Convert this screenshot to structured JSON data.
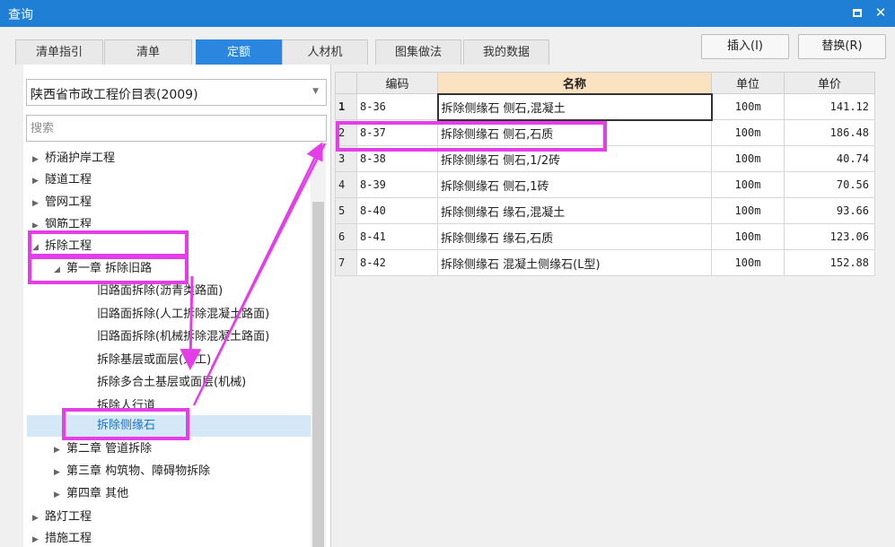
{
  "window": {
    "title": "查询",
    "buttons": {
      "maximize": "",
      "close": "✕"
    }
  },
  "tabs": [
    {
      "label": "清单指引",
      "active": false
    },
    {
      "label": "清单",
      "active": false
    },
    {
      "label": "定额",
      "active": true
    },
    {
      "label": "人材机",
      "active": false
    },
    {
      "label": "图集做法",
      "active": false
    },
    {
      "label": "我的数据",
      "active": false
    }
  ],
  "actions": {
    "insert": "插入(I)",
    "replace": "替换(R)"
  },
  "library": {
    "selected": "陕西省市政工程价目表(2009)"
  },
  "search": {
    "placeholder": "搜索",
    "value": ""
  },
  "tree": [
    {
      "label": "桥涵护岸工程",
      "arrow": "▶"
    },
    {
      "label": "隧道工程",
      "arrow": "▶"
    },
    {
      "label": "管网工程",
      "arrow": "▶"
    },
    {
      "label": "钢筋工程",
      "arrow": "▶"
    },
    {
      "label": "拆除工程",
      "arrow": "◢"
    },
    {
      "label": "第一章 拆除旧路",
      "arrow": "◢"
    },
    {
      "label": "旧路面拆除(沥青类路面)"
    },
    {
      "label": "旧路面拆除(人工拆除混凝土路面)"
    },
    {
      "label": "旧路面拆除(机械拆除混凝土路面)"
    },
    {
      "label": "拆除基层或面层(人工)"
    },
    {
      "label": "拆除多合土基层或面层(机械)"
    },
    {
      "label": "拆除人行道"
    },
    {
      "label": "拆除侧缘石",
      "selected": true
    },
    {
      "label": "第二章 管道拆除",
      "arrow": "▶"
    },
    {
      "label": "第三章 构筑物、障碍物拆除",
      "arrow": "▶"
    },
    {
      "label": "第四章 其他",
      "arrow": "▶"
    },
    {
      "label": "路灯工程",
      "arrow": "▶"
    },
    {
      "label": "措施工程",
      "arrow": "▶"
    }
  ],
  "grid": {
    "headers": {
      "code": "编码",
      "name": "名称",
      "unit": "单位",
      "price": "单价"
    },
    "rows": [
      {
        "no": "1",
        "code": "8-36",
        "name": "拆除侧缘石 侧石,混凝土",
        "unit": "100m",
        "price": "141.12"
      },
      {
        "no": "2",
        "code": "8-37",
        "name": "拆除侧缘石 侧石,石质",
        "unit": "100m",
        "price": "186.48"
      },
      {
        "no": "3",
        "code": "8-38",
        "name": "拆除侧缘石 侧石,1/2砖",
        "unit": "100m",
        "price": "40.74"
      },
      {
        "no": "4",
        "code": "8-39",
        "name": "拆除侧缘石 侧石,1砖",
        "unit": "100m",
        "price": "70.56"
      },
      {
        "no": "5",
        "code": "8-40",
        "name": "拆除侧缘石 缘石,混凝土",
        "unit": "100m",
        "price": "93.66"
      },
      {
        "no": "6",
        "code": "8-41",
        "name": "拆除侧缘石 缘石,石质",
        "unit": "100m",
        "price": "123.06"
      },
      {
        "no": "7",
        "code": "8-42",
        "name": "拆除侧缘石 混凝土侧缘石(L型)",
        "unit": "100m",
        "price": "152.88"
      }
    ]
  },
  "colors": {
    "titlebar": "#1f7fd4",
    "active_tab": "#2a86de",
    "annotation": "#e33ee7",
    "name_header": "#fbe2c0",
    "tree_selection": "#d5e8f7"
  }
}
